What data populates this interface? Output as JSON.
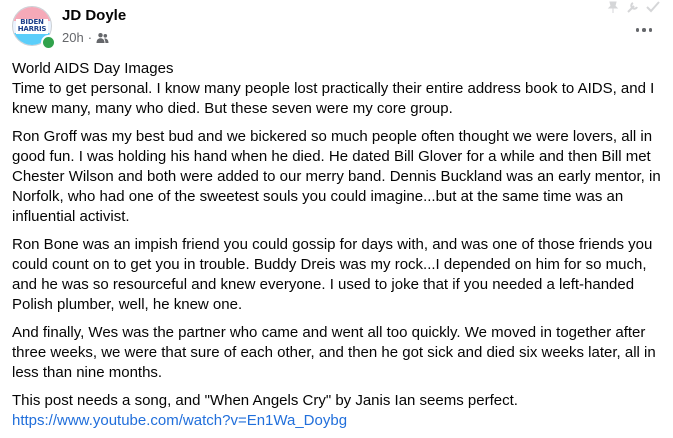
{
  "post": {
    "author": "JD Doyle",
    "avatar_text_line1": "BIDEN",
    "avatar_text_line2": "HARRIS",
    "timestamp": "20h",
    "separator": "·",
    "audience_icon": "friends-icon",
    "more_icon": "more-options-icon",
    "title_line": "World AIDS Day Images",
    "paragraphs": [
      "Time to get personal. I know many people lost practically their entire address book to AIDS, and I knew many, many who died. But these seven were my core group.",
      "Ron Groff was my best bud and we bickered so much people often thought we were lovers, all in good fun. I was holding his hand when he died. He dated Bill Glover for a while and then Bill met Chester Wilson and both were added to our merry band. Dennis Buckland was an early mentor, in Norfolk, who had one of the sweetest souls you could imagine...but at the same time was an influential activist.",
      "Ron Bone was an impish friend you could gossip for days with, and was one of those friends you could count on to get you in trouble. Buddy Dreis was my rock...I depended on him for so much, and he was so resourceful and knew everyone. I used to joke that if you needed a left-handed Polish plumber, well, he knew one.",
      "And finally, Wes was the partner who came and went all too quickly. We moved in together after three weeks, we were that sure of each other, and then he got sick and died six weeks later, all in less than nine months.",
      "This post needs a song, and \"When Angels Cry\" by Janis Ian seems perfect."
    ],
    "link": "https://www.youtube.com/watch?v=En1Wa_Doybg"
  },
  "colors": {
    "text": "#050505",
    "secondary": "#65676b",
    "link": "#216fdb",
    "online": "#31a24c"
  }
}
